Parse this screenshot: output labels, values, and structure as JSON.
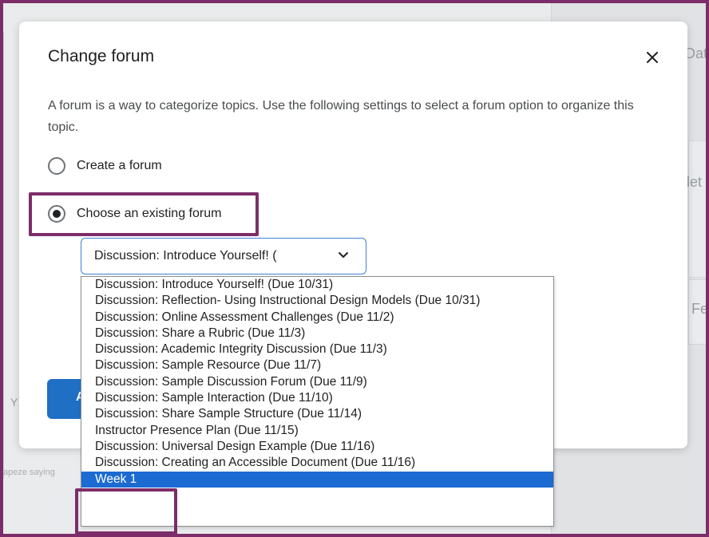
{
  "background": {
    "right_fragments": [
      "Dat",
      "let",
      "Fe"
    ],
    "left_fragments": [
      "Y",
      "apeze saying"
    ]
  },
  "dialog": {
    "title": "Change forum",
    "close_icon": "close-icon",
    "description": "A forum is a way to categorize topics. Use the following settings to select a forum option to organize this topic.",
    "radio_create_label": "Create a forum",
    "radio_existing_label": "Choose an existing forum",
    "selected_radio": "Choose an existing forum",
    "select_value": "Discussion: Introduce Yourself! (",
    "primary_button_fragment": "A"
  },
  "dropdown": {
    "options": [
      "Discussion: Introduce Yourself! (Due 10/31)",
      "Discussion: Reflection- Using Instructional Design Models (Due 10/31)",
      "Discussion: Online Assessment Challenges (Due 11/2)",
      "Discussion: Share a Rubric (Due 11/3)",
      "Discussion: Academic Integrity Discussion (Due 11/3)",
      "Discussion: Sample Resource (Due 11/7)",
      "Discussion: Sample Discussion Forum (Due 11/9)",
      "Discussion: Sample Interaction (Due 11/10)",
      "Discussion: Share Sample Structure (Due 11/14)",
      "Instructor Presence Plan (Due 11/15)",
      "Discussion: Universal Design Example (Due 11/16)",
      "Discussion: Creating an Accessible Document (Due 11/16)",
      "Week 1"
    ],
    "highlighted_option": "Week 1"
  },
  "colors": {
    "annotation_border": "#7c2d69",
    "select_border": "#3f7fd9",
    "selected_option_bg": "#1c6bd2",
    "primary_button": "#1f6fc5"
  }
}
